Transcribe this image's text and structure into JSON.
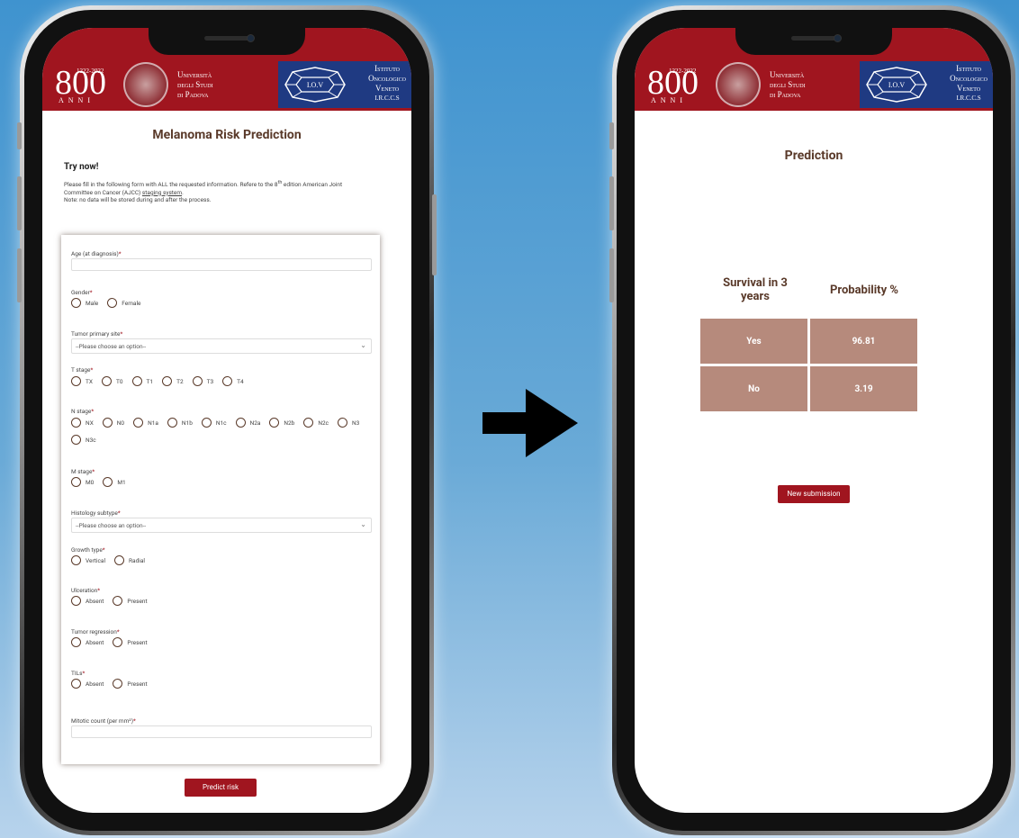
{
  "branding": {
    "uni_logo_800": "800",
    "uni_logo_years": "1222-2022",
    "uni_logo_anni": "ANNI",
    "uni_name_lines": [
      "Università",
      "degli Studi",
      "di Padova"
    ],
    "iov_badge": "I.O.V",
    "iov_name_lines": [
      "Istituto",
      "Oncologico",
      "Veneto",
      "I.R.C.C.S"
    ]
  },
  "form_screen": {
    "title": "Melanoma Risk Prediction",
    "intro_heading": "Try now!",
    "intro_text_1": "Please fill in the following form with ALL the requested information. Refere to the 8",
    "intro_sup": "th",
    "intro_text_2": " edition American Joint Committee on Cancer (AJCC) ",
    "intro_link": "staging system",
    "intro_text_3": ".",
    "intro_note": "Note: no data will be stored during and after the process.",
    "fields": {
      "age_label": "Age (at diagnosis)",
      "gender_label": "Gender",
      "gender_options": [
        "Male",
        "Female"
      ],
      "tumor_site_label": "Tumor primary site",
      "tumor_site_placeholder": "--Please choose an option--",
      "t_stage_label": "T stage",
      "t_stage_options": [
        "TX",
        "T0",
        "T1",
        "T2",
        "T3",
        "T4"
      ],
      "n_stage_label": "N stage",
      "n_stage_options": [
        "NX",
        "N0",
        "N1a",
        "N1b",
        "N1c",
        "N2a",
        "N2b",
        "N2c",
        "N3",
        "N3c"
      ],
      "m_stage_label": "M stage",
      "m_stage_options": [
        "M0",
        "M1"
      ],
      "histology_label": "Histology subtype",
      "histology_placeholder": "--Please choose an option--",
      "growth_label": "Growth type",
      "growth_options": [
        "Vertical",
        "Radial"
      ],
      "ulceration_label": "Ulceration",
      "ulceration_options": [
        "Absent",
        "Present"
      ],
      "regression_label": "Tumor regression",
      "regression_options": [
        "Absent",
        "Present"
      ],
      "tils_label": "TILs",
      "tils_options": [
        "Absent",
        "Present"
      ],
      "mitotic_label": "Mitotic count (per mm²)",
      "required_mark": "*"
    },
    "submit_label": "Predict risk"
  },
  "result_screen": {
    "title": "Prediction",
    "col_survival": "Survival in 3 years",
    "col_probability": "Probability %",
    "rows": [
      {
        "outcome": "Yes",
        "probability": "96.81"
      },
      {
        "outcome": "No",
        "probability": "3.19"
      }
    ],
    "new_submission_label": "New submission"
  },
  "colors": {
    "brand_red": "#a0151f",
    "iov_blue": "#1f3a82",
    "table_cell": "#b68a7c",
    "title_brown": "#5a3a2a"
  }
}
